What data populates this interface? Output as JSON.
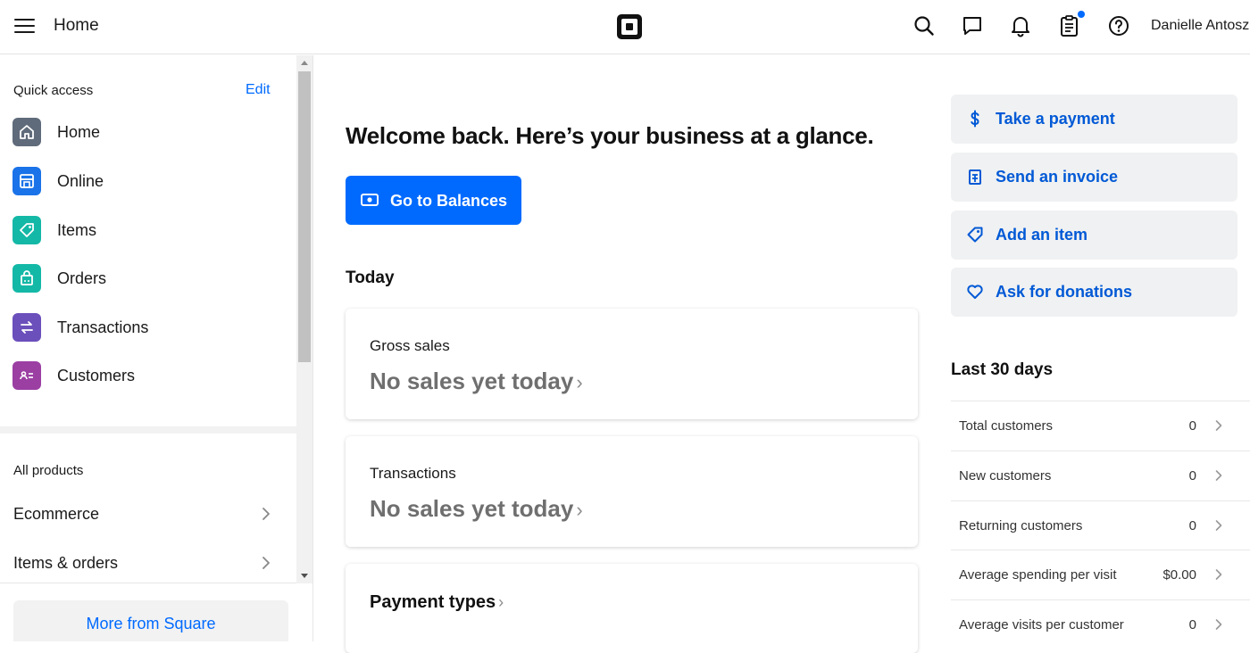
{
  "header": {
    "title": "Home",
    "user_name": "Danielle Antosz"
  },
  "sidebar": {
    "quick_access_label": "Quick access",
    "edit_label": "Edit",
    "items": [
      {
        "label": "Home",
        "icon": "home-icon",
        "color": "#5f6b7a"
      },
      {
        "label": "Online",
        "icon": "storefront-icon",
        "color": "#1a73e8"
      },
      {
        "label": "Items",
        "icon": "tag-icon",
        "color": "#14b8a6"
      },
      {
        "label": "Orders",
        "icon": "shopping-bag-icon",
        "color": "#14b8a6"
      },
      {
        "label": "Transactions",
        "icon": "swap-arrows-icon",
        "color": "#6b4fbb"
      },
      {
        "label": "Customers",
        "icon": "contact-card-icon",
        "color": "#9b3fa3"
      }
    ],
    "all_products_label": "All products",
    "products": [
      {
        "label": "Ecommerce"
      },
      {
        "label": "Items & orders"
      }
    ],
    "more_button_label": "More from Square"
  },
  "main": {
    "welcome_title": "Welcome back. Here’s your business at a glance.",
    "balances_button": "Go to Balances",
    "today_label": "Today",
    "cards": [
      {
        "label": "Gross sales",
        "value": "No sales yet today"
      },
      {
        "label": "Transactions",
        "value": "No sales yet today"
      },
      {
        "title": "Payment types"
      }
    ]
  },
  "actions": [
    {
      "label": "Take a payment",
      "icon": "dollar-icon"
    },
    {
      "label": "Send an invoice",
      "icon": "invoice-icon"
    },
    {
      "label": "Add an item",
      "icon": "tag-icon"
    },
    {
      "label": "Ask for donations",
      "icon": "heart-icon"
    }
  ],
  "last30": {
    "title": "Last 30 days",
    "rows": [
      {
        "label": "Total customers",
        "value": "0"
      },
      {
        "label": "New customers",
        "value": "0"
      },
      {
        "label": "Returning customers",
        "value": "0"
      },
      {
        "label": "Average spending per visit",
        "value": "$0.00"
      },
      {
        "label": "Average visits per customer",
        "value": "0"
      }
    ]
  },
  "colors": {
    "accent": "#006aff",
    "link": "#0059d6"
  }
}
